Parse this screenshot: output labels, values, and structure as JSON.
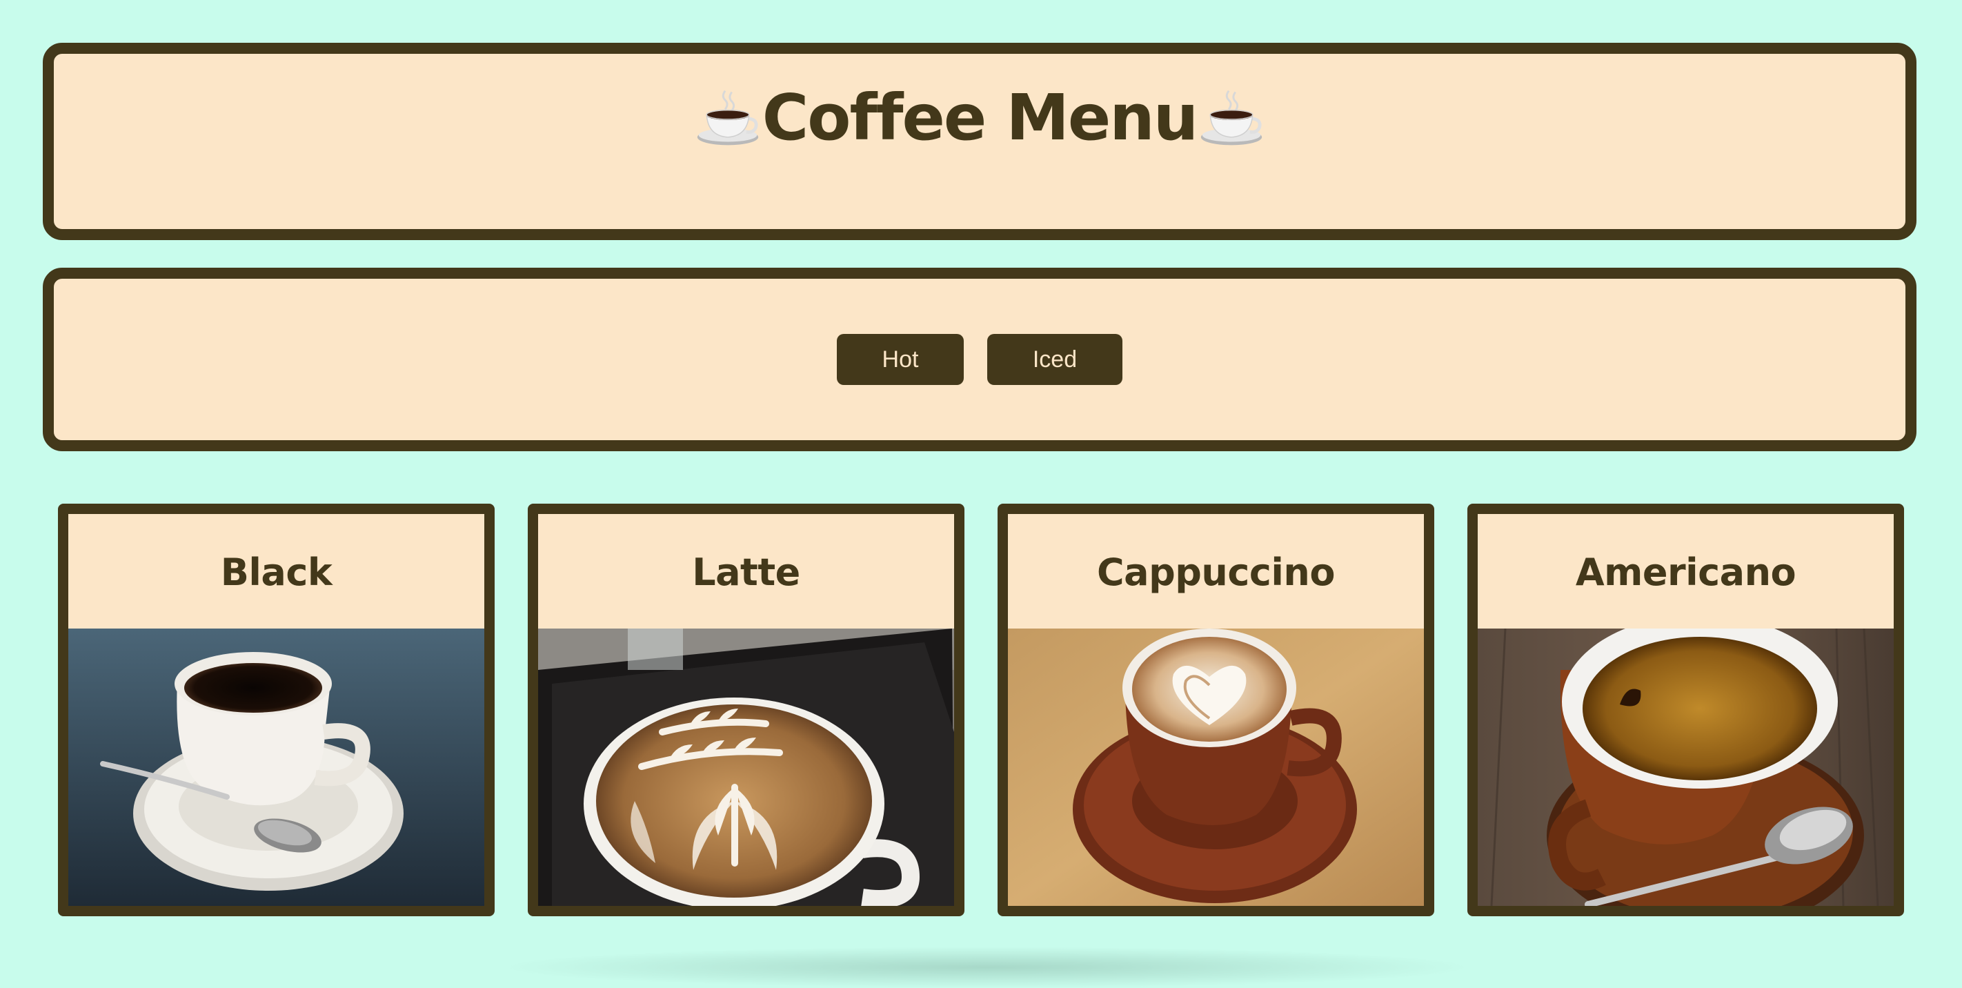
{
  "header": {
    "title": "Coffee Menu",
    "left_icon": "coffee-cup-icon",
    "right_icon": "coffee-cup-icon"
  },
  "filters": {
    "hot_label": "Hot",
    "iced_label": "Iced"
  },
  "menu": {
    "items": [
      {
        "name": "Black",
        "image": "black-coffee-photo"
      },
      {
        "name": "Latte",
        "image": "latte-photo"
      },
      {
        "name": "Cappuccino",
        "image": "cappuccino-photo"
      },
      {
        "name": "Americano",
        "image": "americano-photo"
      }
    ]
  },
  "colors": {
    "background": "#c8fcec",
    "panel": "#fce6c8",
    "accent_dark_brown": "#43381a"
  }
}
